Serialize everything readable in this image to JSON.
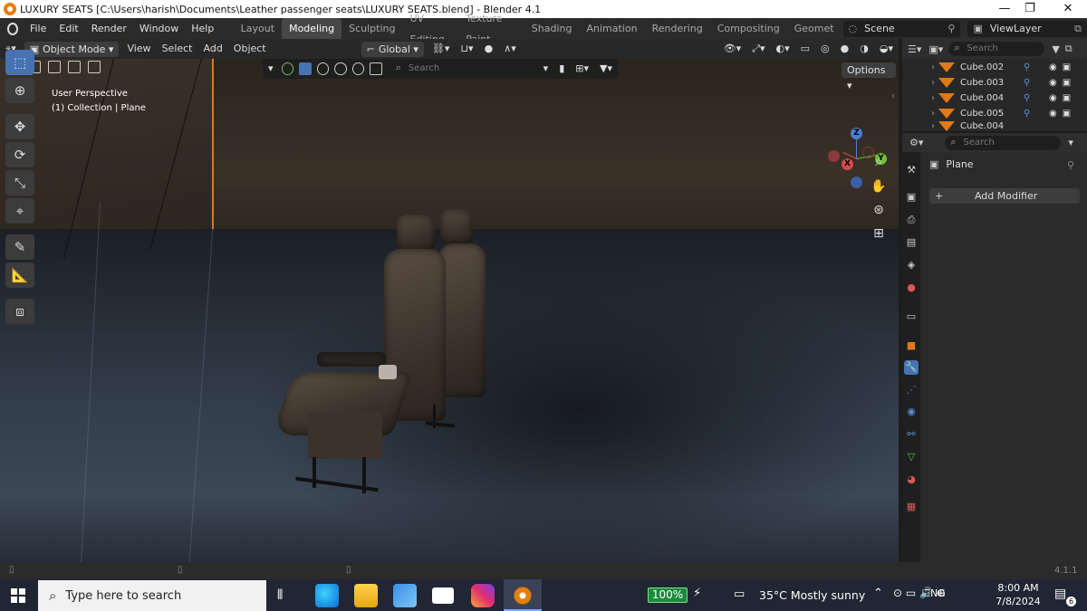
{
  "window": {
    "title": "LUXURY SEATS [C:\\Users\\harish\\Documents\\Leather passenger seats\\LUXURY SEATS.blend] - Blender 4.1",
    "controls": [
      "—",
      "❐",
      "✕"
    ]
  },
  "menu": [
    "File",
    "Edit",
    "Render",
    "Window",
    "Help"
  ],
  "workspaces": [
    "Layout",
    "Modeling",
    "Sculpting",
    "UV Editing",
    "Texture Paint",
    "Shading",
    "Animation",
    "Rendering",
    "Compositing",
    "Geomet"
  ],
  "active_workspace": "Modeling",
  "scene": {
    "name": "Scene",
    "view_layer": "ViewLayer"
  },
  "viewport": {
    "mode": "Object Mode",
    "menus": [
      "View",
      "Select",
      "Add",
      "Object"
    ],
    "transform_orientation": "Global",
    "search_placeholder": "Search",
    "options_label": "Options",
    "info_line1": "User Perspective",
    "info_line2": "(1) Collection | Plane",
    "gizmo": {
      "z": "Z",
      "y": "Y",
      "x": "X"
    }
  },
  "outliner": {
    "search_placeholder": "Search",
    "items": [
      "Cube.002",
      "Cube.003",
      "Cube.004",
      "Cube.005",
      "Cube.004"
    ]
  },
  "properties": {
    "search_placeholder": "Search",
    "object_name": "Plane",
    "add_modifier_label": "Add Modifier"
  },
  "statusbar": {
    "version": "4.1.1"
  },
  "taskbar": {
    "search_placeholder": "Type here to search",
    "battery": "100%",
    "weather": "35°C  Mostly sunny",
    "language": "ENG",
    "time": "8:00 AM",
    "date": "7/8/2024",
    "notifications": "6"
  },
  "colors": {
    "accent": "#4772b3",
    "selection_orange": "#e0791a",
    "blender_orange": "#e87d0d",
    "taskbar": "#202634"
  }
}
